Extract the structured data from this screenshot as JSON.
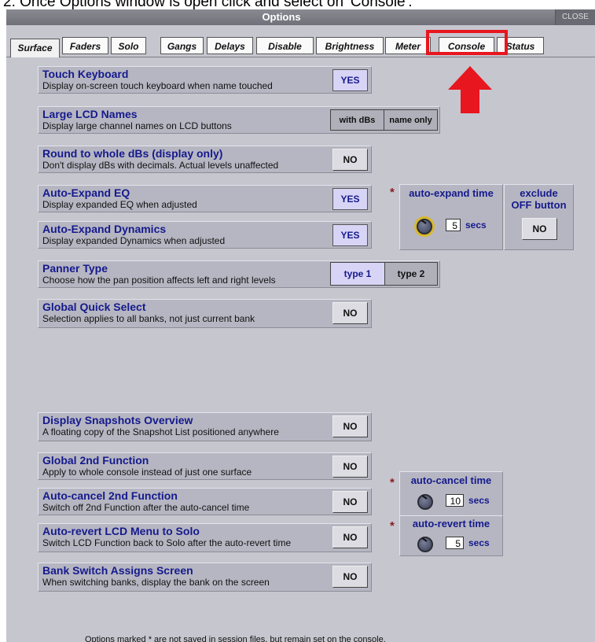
{
  "caption": "2. Once Options window is open click and select on 'Console'.",
  "window": {
    "title": "Options",
    "close_label": "CLOSE"
  },
  "tabs": [
    "Surface",
    "Faders",
    "Solo",
    "Gangs",
    "Delays",
    "Disable",
    "Brightness",
    "Meter",
    "Console",
    "Status"
  ],
  "active_tab": "Surface",
  "annotation": {
    "highlight_color": "#e8161e",
    "arrow_icon": "arrow-up-icon"
  },
  "settings": {
    "touch_keyboard": {
      "title": "Touch Keyboard",
      "desc": "Display on-screen touch keyboard when name touched",
      "value": "YES"
    },
    "large_lcd": {
      "title": "Large LCD Names",
      "desc": "Display large channel names on LCD buttons",
      "opt1": "with dBs",
      "opt2": "name only"
    },
    "round_db": {
      "title": "Round to whole dBs (display only)",
      "desc": "Don't display dBs with decimals. Actual levels unaffected",
      "value": "NO"
    },
    "auto_eq": {
      "title": "Auto-Expand EQ",
      "desc": "Display expanded EQ when adjusted",
      "value": "YES"
    },
    "auto_dyn": {
      "title": "Auto-Expand Dynamics",
      "desc": "Display expanded Dynamics when adjusted",
      "value": "YES"
    },
    "panner": {
      "title": "Panner Type",
      "desc": "Choose how the pan position affects left and right levels",
      "opt1": "type 1",
      "opt2": "type 2"
    },
    "global_qs": {
      "title": "Global Quick Select",
      "desc": "Selection applies to all banks, not just current bank",
      "value": "NO"
    },
    "snapshots": {
      "title": "Display Snapshots Overview",
      "desc": "A floating copy of the Snapshot List positioned anywhere",
      "value": "NO"
    },
    "global_2nd": {
      "title": "Global 2nd Function",
      "desc": "Apply to whole console instead of just one surface",
      "value": "NO"
    },
    "auto_cancel": {
      "title": "Auto-cancel 2nd Function",
      "desc": "Switch off 2nd Function after the auto-cancel time",
      "value": "NO"
    },
    "auto_revert": {
      "title": "Auto-revert LCD Menu to Solo",
      "desc": "Switch LCD Function back to Solo after the auto-revert time",
      "value": "NO"
    },
    "bank_switch": {
      "title": "Bank Switch Assigns Screen",
      "desc": "When switching banks, display the bank on the screen",
      "value": "NO"
    }
  },
  "auto_expand": {
    "star": "*",
    "label": "auto-expand time",
    "value": "5",
    "unit": "secs"
  },
  "exclude_off": {
    "label1": "exclude",
    "label2": "OFF button",
    "value": "NO"
  },
  "auto_cancel_time": {
    "star": "*",
    "label": "auto-cancel time",
    "value": "10",
    "unit": "secs"
  },
  "auto_revert_time": {
    "star": "*",
    "label": "auto-revert time",
    "value": "5",
    "unit": "secs"
  },
  "footer": "Options marked * are not saved in session files, but remain set on the console."
}
